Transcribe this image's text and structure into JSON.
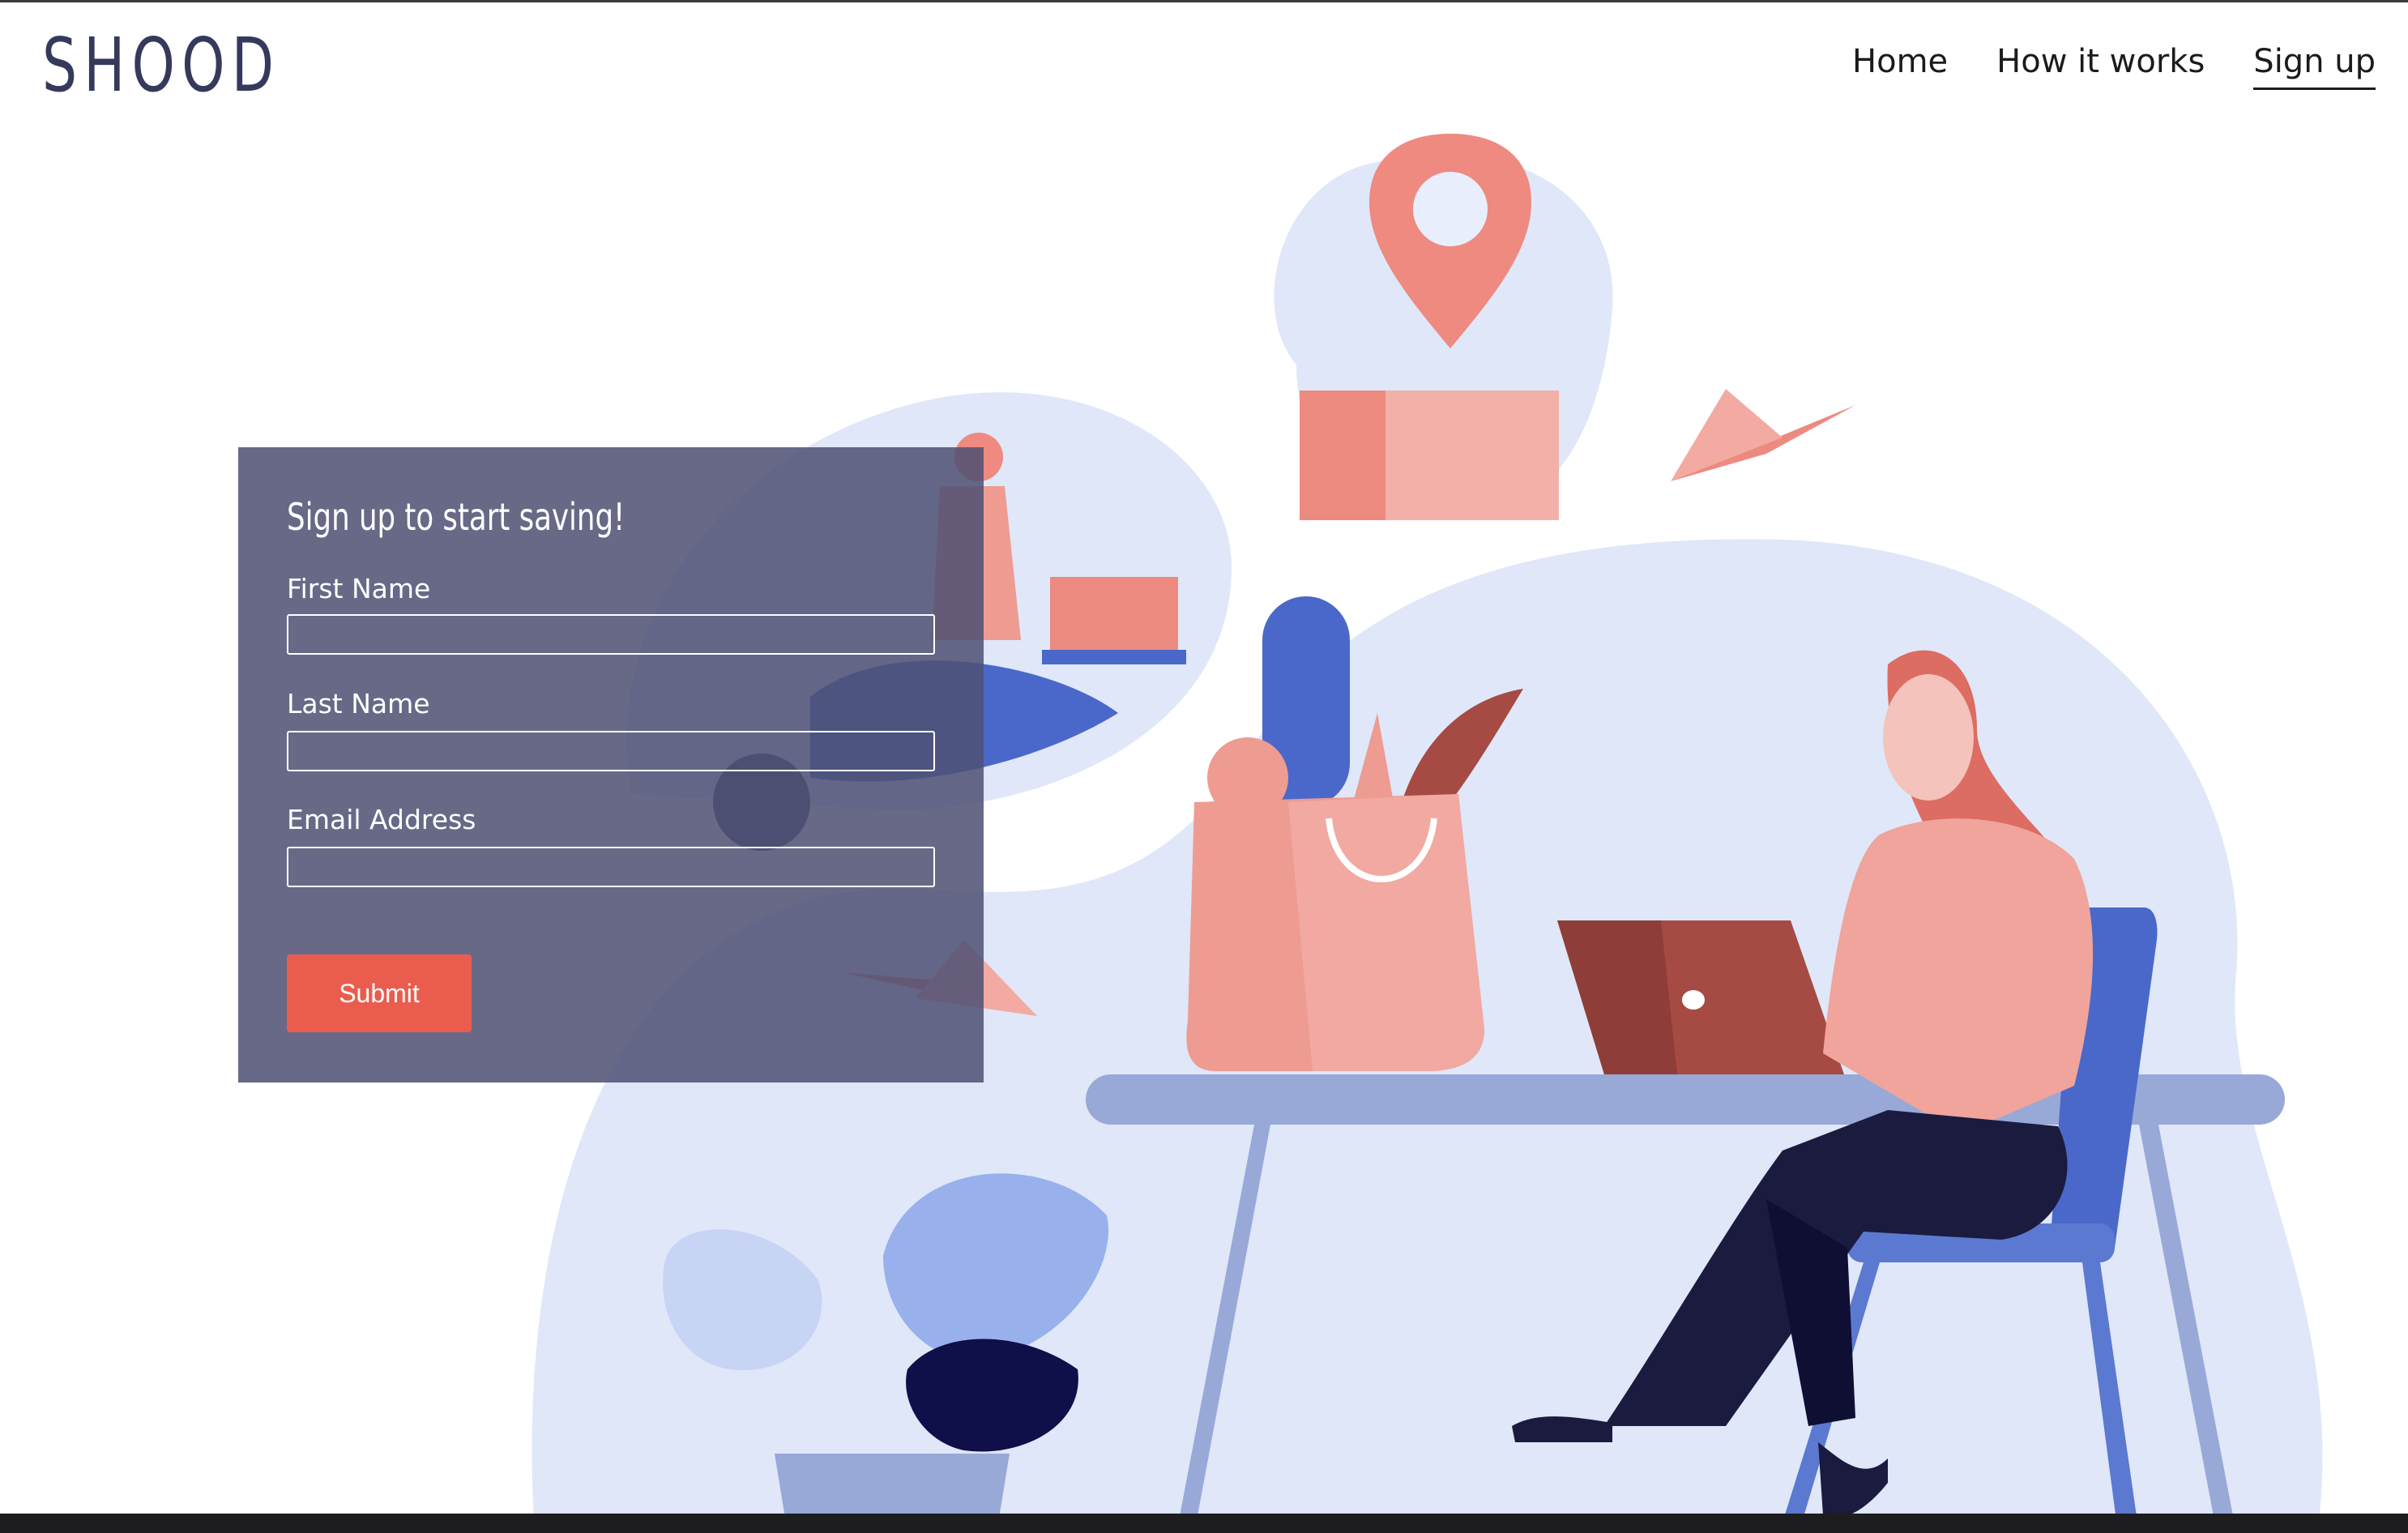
{
  "brand": {
    "name": "SHOOD"
  },
  "nav": {
    "items": [
      {
        "label": "Home",
        "active": false
      },
      {
        "label": "How it works",
        "active": false
      },
      {
        "label": "Sign up",
        "active": true
      }
    ]
  },
  "signup_form": {
    "title": "Sign up to start saving!",
    "fields": [
      {
        "label": "First Name",
        "value": ""
      },
      {
        "label": "Last Name",
        "value": ""
      },
      {
        "label": "Email Address",
        "value": ""
      }
    ],
    "submit_label": "Submit"
  },
  "colors": {
    "brand_text": "#353a5c",
    "panel": "#4e5073",
    "accent": "#ea5d4e",
    "blob": "#dfe7f8",
    "coral": "#ee9b92",
    "navy": "#1b1b3f",
    "blue": "#4a68c9"
  },
  "icons": {
    "hero": "grocery-delivery-illustration",
    "pin": "location-pin-icon",
    "plane": "paper-plane-icon"
  }
}
